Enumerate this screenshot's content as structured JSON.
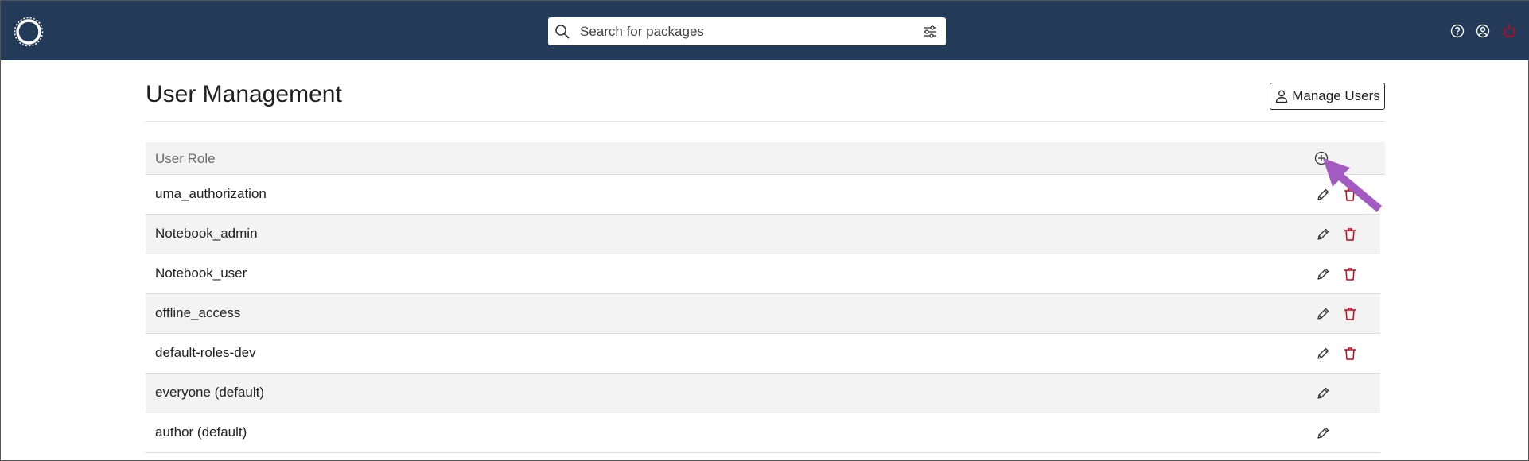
{
  "header": {
    "search": {
      "placeholder": "Search for packages",
      "value": ""
    }
  },
  "page": {
    "title": "User Management",
    "manage_users_label": "Manage Users"
  },
  "table": {
    "column_header": "User Role",
    "rows": [
      {
        "label": "uma_authorization",
        "deletable": true
      },
      {
        "label": "Notebook_admin",
        "deletable": true
      },
      {
        "label": "Notebook_user",
        "deletable": true
      },
      {
        "label": "offline_access",
        "deletable": true
      },
      {
        "label": "default-roles-dev",
        "deletable": true
      },
      {
        "label": "everyone (default)",
        "deletable": false
      },
      {
        "label": "author (default)",
        "deletable": false
      }
    ]
  },
  "colors": {
    "header_bg": "#243a59",
    "delete_red": "#d0021b",
    "annotation_arrow": "#a35bc2"
  },
  "icons": [
    "logo-icon",
    "search-icon",
    "filter-icon",
    "help-icon",
    "account-icon",
    "power-icon",
    "user-icon",
    "add-circle-icon",
    "pencil-icon",
    "trash-icon"
  ]
}
